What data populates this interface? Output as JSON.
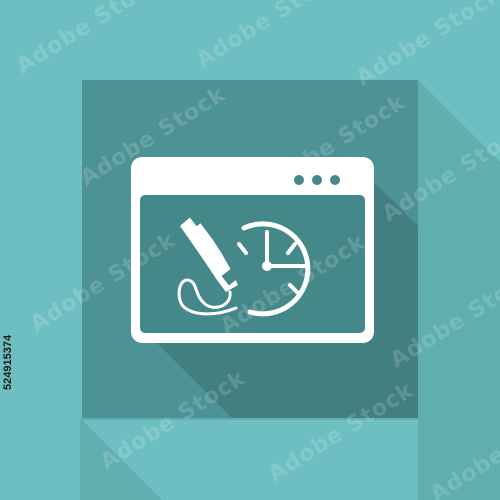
{
  "image": {
    "watermark_text": "Adobe Stock",
    "stock_id": "524915374",
    "icon_semantics": [
      "browser-window-icon",
      "telephone-handset-icon",
      "clock-icon"
    ],
    "colors": {
      "background": "#6dbfc1",
      "tile": "#45888a",
      "tile_light": "#4d9294",
      "long_shadow": "#3a7476",
      "window": "#ffffff",
      "window_body": "#45888a"
    }
  }
}
